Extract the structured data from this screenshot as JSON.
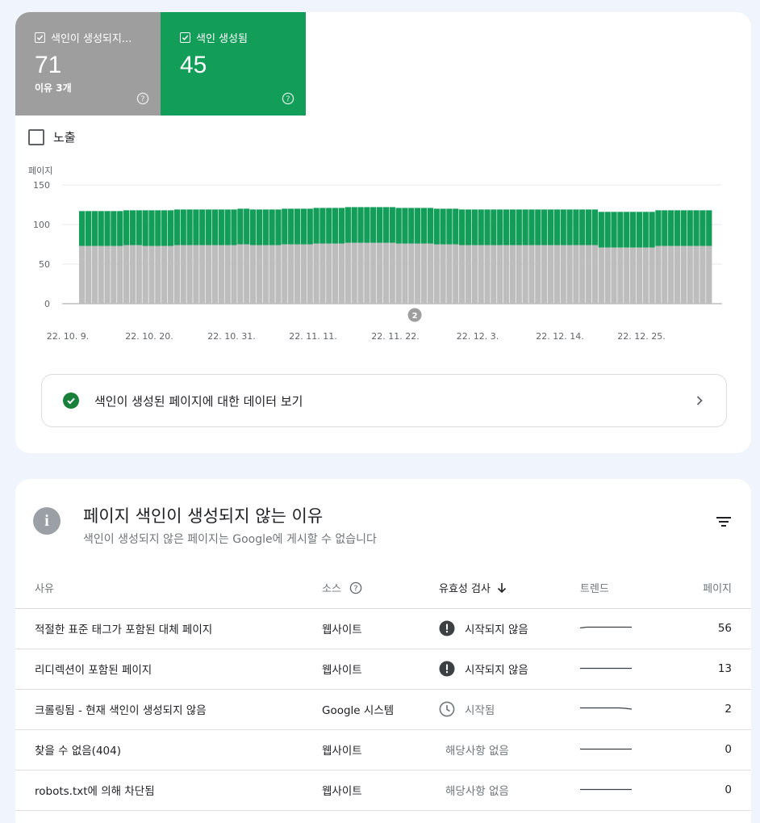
{
  "tiles": {
    "not_indexed": {
      "label": "색인이 생성되지...",
      "count": "71",
      "sub": "이유 3개",
      "color": "#9e9e9e"
    },
    "indexed": {
      "label": "색인 생성됨",
      "count": "45",
      "color": "#129d59"
    }
  },
  "impressions_label": "노출",
  "chart_data": {
    "type": "bar",
    "stacked": true,
    "ylabel": "페이지",
    "ylim": [
      0,
      150
    ],
    "yticks": [
      0,
      50,
      100,
      150
    ],
    "xticks": [
      "22. 10. 9.",
      "22. 10. 20.",
      "22. 10. 31.",
      "22. 11. 11.",
      "22. 11. 22.",
      "22. 12. 3.",
      "22. 12. 14.",
      "22. 12. 25."
    ],
    "annotation": "2",
    "series": [
      {
        "name": "색인이 생성되지 않음",
        "color": "#bdbdbd",
        "values": [
          73,
          73,
          73,
          73,
          73,
          73,
          73,
          74,
          74,
          74,
          73,
          73,
          73,
          73,
          73,
          74,
          74,
          74,
          74,
          74,
          74,
          74,
          74,
          74,
          74,
          75,
          75,
          74,
          74,
          74,
          74,
          74,
          75,
          75,
          75,
          75,
          75,
          76,
          76,
          76,
          76,
          76,
          77,
          77,
          77,
          77,
          77,
          77,
          77,
          77,
          76,
          76,
          76,
          76,
          76,
          76,
          75,
          75,
          75,
          75,
          74,
          74,
          74,
          74,
          74,
          74,
          74,
          74,
          74,
          74,
          74,
          74,
          74,
          74,
          74,
          74,
          74,
          74,
          74,
          74,
          74,
          74,
          71,
          71,
          71,
          71,
          71,
          71,
          71,
          71,
          71,
          73,
          73,
          73,
          73,
          73,
          73,
          73,
          73,
          73
        ]
      },
      {
        "name": "색인 생성됨",
        "color": "#129d59",
        "values": [
          44,
          44,
          44,
          44,
          44,
          44,
          44,
          44,
          44,
          44,
          45,
          45,
          45,
          45,
          45,
          45,
          45,
          45,
          45,
          45,
          45,
          45,
          45,
          45,
          45,
          45,
          45,
          45,
          45,
          45,
          45,
          45,
          45,
          45,
          45,
          45,
          45,
          45,
          45,
          45,
          45,
          45,
          45,
          45,
          45,
          45,
          45,
          45,
          45,
          45,
          45,
          45,
          45,
          45,
          45,
          45,
          45,
          45,
          45,
          45,
          45,
          45,
          45,
          45,
          45,
          45,
          45,
          45,
          45,
          45,
          45,
          45,
          45,
          45,
          45,
          45,
          45,
          45,
          45,
          45,
          45,
          45,
          45,
          45,
          45,
          45,
          45,
          45,
          45,
          45,
          45,
          45,
          45,
          45,
          45,
          45,
          45,
          45,
          45,
          45
        ]
      }
    ]
  },
  "link_row_label": "색인이 생성된 페이지에 대한 데이터 보기",
  "section": {
    "title": "페이지 색인이 생성되지 않는 이유",
    "subtitle": "색인이 생성되지 않은 페이지는 Google에 게시할 수 없습니다"
  },
  "table": {
    "headers": {
      "reason": "사유",
      "source": "소스",
      "validation": "유효성 검사",
      "trend": "트렌드",
      "pages": "페이지"
    },
    "rows": [
      {
        "reason": "적절한 표준 태그가 포함된 대체 페이지",
        "source": "웹사이트",
        "status_icon": "alert-icon",
        "validation": "시작되지 않음",
        "pages": "56"
      },
      {
        "reason": "리디렉션이 포함된 페이지",
        "source": "웹사이트",
        "status_icon": "alert-icon",
        "validation": "시작되지 않음",
        "pages": "13"
      },
      {
        "reason": "크롤링됨 - 현재 색인이 생성되지 않음",
        "source": "Google 시스템",
        "status_icon": "clock-icon",
        "validation": "시작됨",
        "pages": "2"
      },
      {
        "reason": "찾을 수 없음(404)",
        "source": "웹사이트",
        "status_icon": "",
        "validation": "해당사항 없음",
        "pages": "0"
      },
      {
        "reason": "robots.txt에 의해 차단됨",
        "source": "웹사이트",
        "status_icon": "",
        "validation": "해당사항 없음",
        "pages": "0"
      }
    ]
  }
}
